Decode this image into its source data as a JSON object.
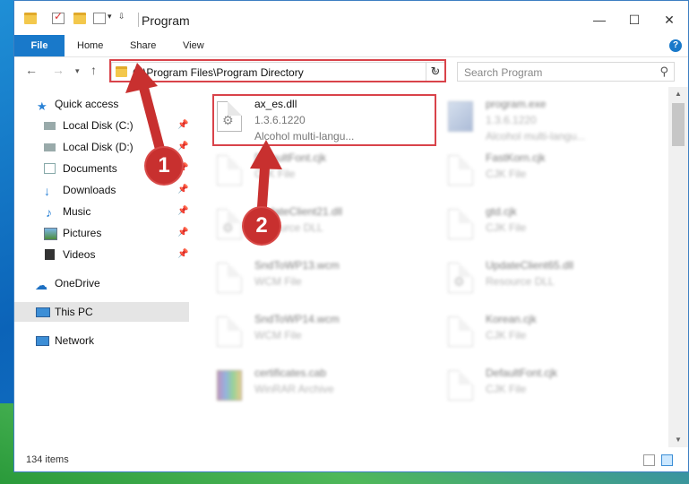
{
  "window": {
    "title": "Program",
    "controls": {
      "minimize": "—",
      "maximize": "☐",
      "close": "✕"
    }
  },
  "ribbon": {
    "tabs": [
      "File",
      "Home",
      "Share",
      "View"
    ],
    "help": "?"
  },
  "address_bar": {
    "path": "C:\\Program Files\\Program Directory",
    "search_placeholder": "Search Program"
  },
  "nav_pane": {
    "quick_access": "Quick access",
    "items": [
      {
        "label": "Local Disk (C:)",
        "icon": "drive-icon",
        "pinned": true
      },
      {
        "label": "Local Disk (D:)",
        "icon": "drive-icon",
        "pinned": true
      },
      {
        "label": "Documents",
        "icon": "documents-icon",
        "pinned": true
      },
      {
        "label": "Downloads",
        "icon": "downloads-icon",
        "pinned": true
      },
      {
        "label": "Music",
        "icon": "music-icon",
        "pinned": true
      },
      {
        "label": "Pictures",
        "icon": "pictures-icon",
        "pinned": true
      },
      {
        "label": "Videos",
        "icon": "videos-icon",
        "pinned": true
      }
    ],
    "onedrive": "OneDrive",
    "this_pc": "This PC",
    "network": "Network"
  },
  "files": [
    {
      "name": "ax_es.dll",
      "line2": "1.3.6.1220",
      "line3": "Alcohol multi-langu...",
      "icon": "dll-icon",
      "highlighted": true
    },
    {
      "name": "program.exe",
      "line2": "1.3.6.1220",
      "line3": "Alcohol multi-langu...",
      "icon": "exe-icon"
    },
    {
      "name": "DefaultFont.cjk",
      "line2": "CJK File",
      "icon": "document-icon"
    },
    {
      "name": "FastKorn.cjk",
      "line2": "CJK File",
      "icon": "document-icon"
    },
    {
      "name": "UpdateClient21.dll",
      "line2": "Resource DLL",
      "icon": "dll-icon"
    },
    {
      "name": "gtd.cjk",
      "line2": "CJK File",
      "icon": "document-icon"
    },
    {
      "name": "SndToWP13.wcm",
      "line2": "WCM File",
      "icon": "document-icon"
    },
    {
      "name": "UpdateClient65.dll",
      "line2": "Resource DLL",
      "icon": "dll-icon"
    },
    {
      "name": "SndToWP14.wcm",
      "line2": "WCM File",
      "icon": "document-icon"
    },
    {
      "name": "Korean.cjk",
      "line2": "CJK File",
      "icon": "document-icon"
    },
    {
      "name": "certificates.cab",
      "line2": "WinRAR Archive",
      "icon": "winrar-icon"
    },
    {
      "name": "DefaultFont.cjk",
      "line2": "CJK File",
      "icon": "document-icon"
    }
  ],
  "status": {
    "item_count": "134 items"
  },
  "annotations": {
    "step1": "1",
    "step2": "2"
  },
  "colors": {
    "accent": "#1979ca",
    "highlight": "#d9434a",
    "badge": "#c8302f"
  }
}
